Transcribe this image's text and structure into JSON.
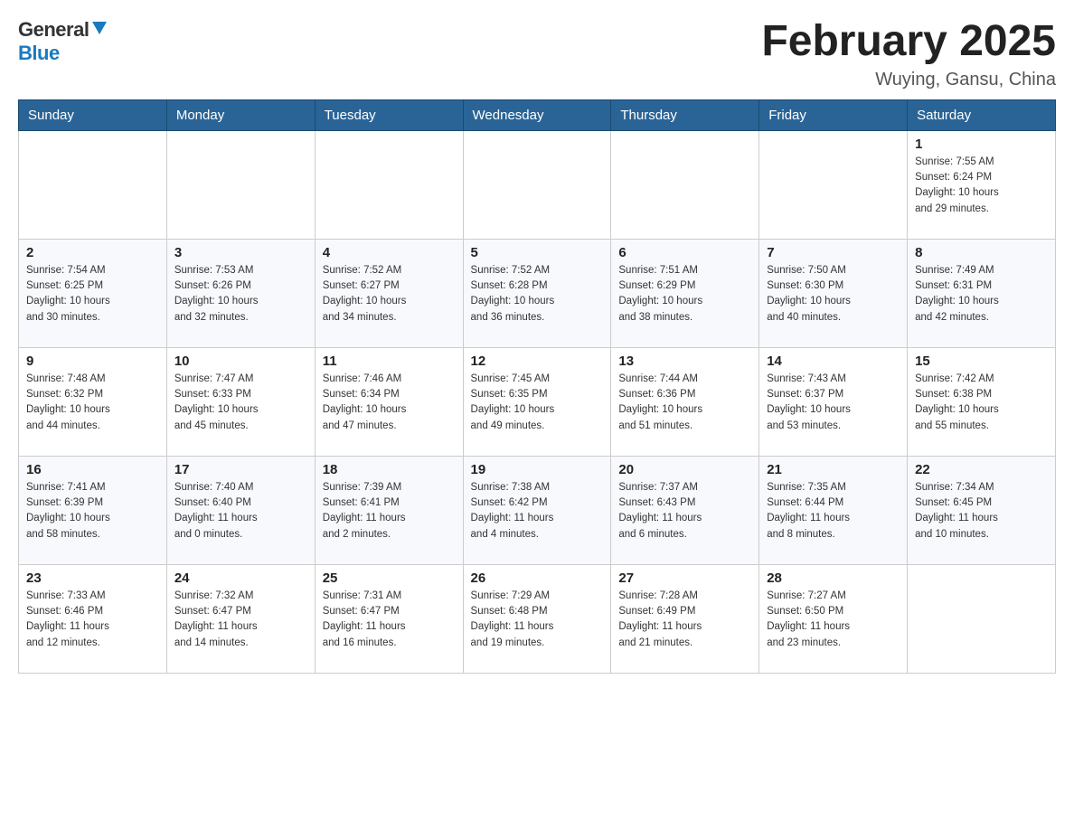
{
  "header": {
    "logo": {
      "general": "General",
      "blue": "Blue"
    },
    "title": "February 2025",
    "location": "Wuying, Gansu, China"
  },
  "weekdays": [
    "Sunday",
    "Monday",
    "Tuesday",
    "Wednesday",
    "Thursday",
    "Friday",
    "Saturday"
  ],
  "weeks": [
    [
      {
        "day": "",
        "info": ""
      },
      {
        "day": "",
        "info": ""
      },
      {
        "day": "",
        "info": ""
      },
      {
        "day": "",
        "info": ""
      },
      {
        "day": "",
        "info": ""
      },
      {
        "day": "",
        "info": ""
      },
      {
        "day": "1",
        "info": "Sunrise: 7:55 AM\nSunset: 6:24 PM\nDaylight: 10 hours\nand 29 minutes."
      }
    ],
    [
      {
        "day": "2",
        "info": "Sunrise: 7:54 AM\nSunset: 6:25 PM\nDaylight: 10 hours\nand 30 minutes."
      },
      {
        "day": "3",
        "info": "Sunrise: 7:53 AM\nSunset: 6:26 PM\nDaylight: 10 hours\nand 32 minutes."
      },
      {
        "day": "4",
        "info": "Sunrise: 7:52 AM\nSunset: 6:27 PM\nDaylight: 10 hours\nand 34 minutes."
      },
      {
        "day": "5",
        "info": "Sunrise: 7:52 AM\nSunset: 6:28 PM\nDaylight: 10 hours\nand 36 minutes."
      },
      {
        "day": "6",
        "info": "Sunrise: 7:51 AM\nSunset: 6:29 PM\nDaylight: 10 hours\nand 38 minutes."
      },
      {
        "day": "7",
        "info": "Sunrise: 7:50 AM\nSunset: 6:30 PM\nDaylight: 10 hours\nand 40 minutes."
      },
      {
        "day": "8",
        "info": "Sunrise: 7:49 AM\nSunset: 6:31 PM\nDaylight: 10 hours\nand 42 minutes."
      }
    ],
    [
      {
        "day": "9",
        "info": "Sunrise: 7:48 AM\nSunset: 6:32 PM\nDaylight: 10 hours\nand 44 minutes."
      },
      {
        "day": "10",
        "info": "Sunrise: 7:47 AM\nSunset: 6:33 PM\nDaylight: 10 hours\nand 45 minutes."
      },
      {
        "day": "11",
        "info": "Sunrise: 7:46 AM\nSunset: 6:34 PM\nDaylight: 10 hours\nand 47 minutes."
      },
      {
        "day": "12",
        "info": "Sunrise: 7:45 AM\nSunset: 6:35 PM\nDaylight: 10 hours\nand 49 minutes."
      },
      {
        "day": "13",
        "info": "Sunrise: 7:44 AM\nSunset: 6:36 PM\nDaylight: 10 hours\nand 51 minutes."
      },
      {
        "day": "14",
        "info": "Sunrise: 7:43 AM\nSunset: 6:37 PM\nDaylight: 10 hours\nand 53 minutes."
      },
      {
        "day": "15",
        "info": "Sunrise: 7:42 AM\nSunset: 6:38 PM\nDaylight: 10 hours\nand 55 minutes."
      }
    ],
    [
      {
        "day": "16",
        "info": "Sunrise: 7:41 AM\nSunset: 6:39 PM\nDaylight: 10 hours\nand 58 minutes."
      },
      {
        "day": "17",
        "info": "Sunrise: 7:40 AM\nSunset: 6:40 PM\nDaylight: 11 hours\nand 0 minutes."
      },
      {
        "day": "18",
        "info": "Sunrise: 7:39 AM\nSunset: 6:41 PM\nDaylight: 11 hours\nand 2 minutes."
      },
      {
        "day": "19",
        "info": "Sunrise: 7:38 AM\nSunset: 6:42 PM\nDaylight: 11 hours\nand 4 minutes."
      },
      {
        "day": "20",
        "info": "Sunrise: 7:37 AM\nSunset: 6:43 PM\nDaylight: 11 hours\nand 6 minutes."
      },
      {
        "day": "21",
        "info": "Sunrise: 7:35 AM\nSunset: 6:44 PM\nDaylight: 11 hours\nand 8 minutes."
      },
      {
        "day": "22",
        "info": "Sunrise: 7:34 AM\nSunset: 6:45 PM\nDaylight: 11 hours\nand 10 minutes."
      }
    ],
    [
      {
        "day": "23",
        "info": "Sunrise: 7:33 AM\nSunset: 6:46 PM\nDaylight: 11 hours\nand 12 minutes."
      },
      {
        "day": "24",
        "info": "Sunrise: 7:32 AM\nSunset: 6:47 PM\nDaylight: 11 hours\nand 14 minutes."
      },
      {
        "day": "25",
        "info": "Sunrise: 7:31 AM\nSunset: 6:47 PM\nDaylight: 11 hours\nand 16 minutes."
      },
      {
        "day": "26",
        "info": "Sunrise: 7:29 AM\nSunset: 6:48 PM\nDaylight: 11 hours\nand 19 minutes."
      },
      {
        "day": "27",
        "info": "Sunrise: 7:28 AM\nSunset: 6:49 PM\nDaylight: 11 hours\nand 21 minutes."
      },
      {
        "day": "28",
        "info": "Sunrise: 7:27 AM\nSunset: 6:50 PM\nDaylight: 11 hours\nand 23 minutes."
      },
      {
        "day": "",
        "info": ""
      }
    ]
  ]
}
